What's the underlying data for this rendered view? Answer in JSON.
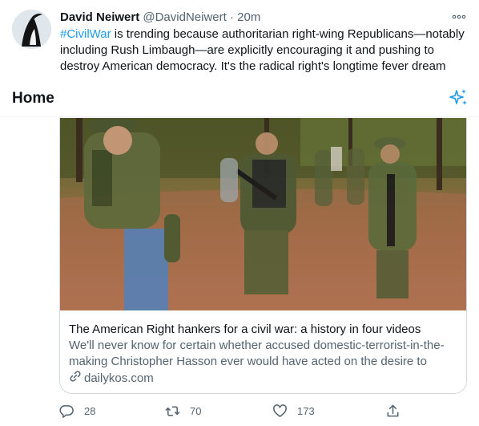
{
  "tweet": {
    "author_name": "David Neiwert",
    "author_handle": "@DavidNeiwert",
    "separator": "·",
    "time": "20m",
    "hashtag": "#CivilWar",
    "text": " is trending because authoritarian right-wing Republicans—notably including Rush Limbaugh—are explicitly encouraging it and pushing to destroy American democracy. It's the radical right's longtime fever dream",
    "more_icon": "more-icon"
  },
  "header": {
    "title": "Home",
    "icon": "sparkle-icon"
  },
  "card": {
    "title": "The American Right hankers for a civil war: a history in four videos",
    "description": "We'll never know for certain whether accused domestic-terrorist-in-the-making Christopher Hasson ever would have acted on the desire to spar…",
    "link_icon": "link-icon",
    "domain": "dailykos.com"
  },
  "actions": {
    "reply_count": "28",
    "retweet_count": "70",
    "like_count": "173"
  },
  "colors": {
    "accent": "#1d9bf0",
    "text": "#0f1419",
    "muted": "#536471",
    "border": "#cfd9de"
  }
}
